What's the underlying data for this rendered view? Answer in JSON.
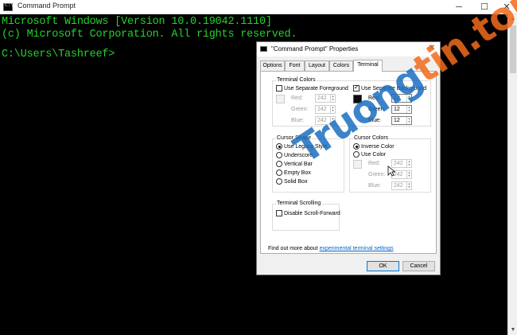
{
  "window": {
    "title": "Command Prompt",
    "controls": {
      "minimize": "─",
      "maximize": "☐",
      "close": "✕"
    }
  },
  "console": {
    "lines": [
      "Microsoft Windows [Version 10.0.19042.1110]",
      "(c) Microsoft Corporation. All rights reserved.",
      "",
      "C:\\Users\\Tashreef>"
    ]
  },
  "dialog": {
    "title": "\"Command Prompt\" Properties",
    "close": "✕",
    "tabs": [
      "Options",
      "Font",
      "Layout",
      "Colors",
      "Terminal"
    ],
    "active_tab": "Terminal",
    "terminal_colors": {
      "label": "Terminal Colors",
      "fg_checkbox": "Use Separate Foreground",
      "bg_checkbox": "Use Separate Background",
      "fg": {
        "red_label": "Red:",
        "green_label": "Green:",
        "blue_label": "Blue:",
        "red": "242",
        "green": "242",
        "blue": "242",
        "swatch": "#f2f2f2"
      },
      "bg": {
        "red_label": "Red:",
        "green_label": "Green:",
        "blue_label": "Blue:",
        "red": "12",
        "green": "12",
        "blue": "12",
        "swatch": "#0c0c0c"
      }
    },
    "cursor_shape": {
      "label": "Cursor Shape",
      "options": [
        "Use Legacy Style",
        "Underscore",
        "Vertical Bar",
        "Empty Box",
        "Solid Box"
      ],
      "selected": "Use Legacy Style"
    },
    "cursor_colors": {
      "label": "Cursor Colors",
      "options": [
        "Inverse Color",
        "Use Color"
      ],
      "selected": "Inverse Color",
      "red_label": "Red:",
      "green_label": "Green:",
      "blue_label": "Blue:",
      "red": "242",
      "green": "242",
      "blue": "242",
      "swatch": "#f2f2f2"
    },
    "terminal_scrolling": {
      "label": "Terminal Scrolling",
      "checkbox": "Disable Scroll-Forward"
    },
    "footer_text": "Find out more about ",
    "footer_link": "experimental terminal settings",
    "ok": "OK",
    "cancel": "Cancel"
  },
  "watermark": {
    "part1": "Truong",
    "part2": "tin",
    "part3": ".top"
  },
  "colors": {
    "console_text": "#24d32c",
    "link": "#0066cc",
    "accent": "#0078d7"
  }
}
